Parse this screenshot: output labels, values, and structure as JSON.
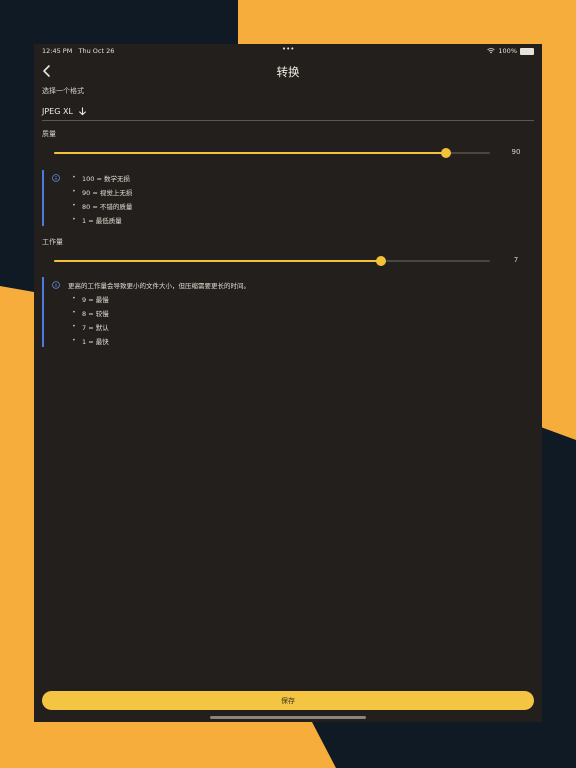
{
  "status_bar": {
    "time": "12:45 PM",
    "date": "Thu Oct 26",
    "dots": "•••",
    "battery": "100%",
    "battery_level": 1.0
  },
  "nav": {
    "title": "转换"
  },
  "format": {
    "label": "选择一个格式",
    "value": "JPEG XL"
  },
  "quality": {
    "label": "质量",
    "value": "90",
    "level": 0.9,
    "info_items": [
      "100 = 数学无损",
      "90 = 视觉上无损",
      "80 = 不错的质量",
      "1 = 最低质量"
    ]
  },
  "effort": {
    "label": "工作量",
    "value": "7",
    "level": 0.75,
    "info_text": "更高的工作量会导致更小的文件大小，但压缩需要更长的时间。",
    "info_items": [
      "9 = 最慢",
      "8 = 较慢",
      "7 = 默认",
      "1 = 最快"
    ]
  },
  "save_label": "保存",
  "colors": {
    "accent": "#f3c23a",
    "info_border": "#4e7ae0",
    "panel": "#221f1c",
    "background": "#0f1a24",
    "background_accent": "#f7ad3c"
  }
}
